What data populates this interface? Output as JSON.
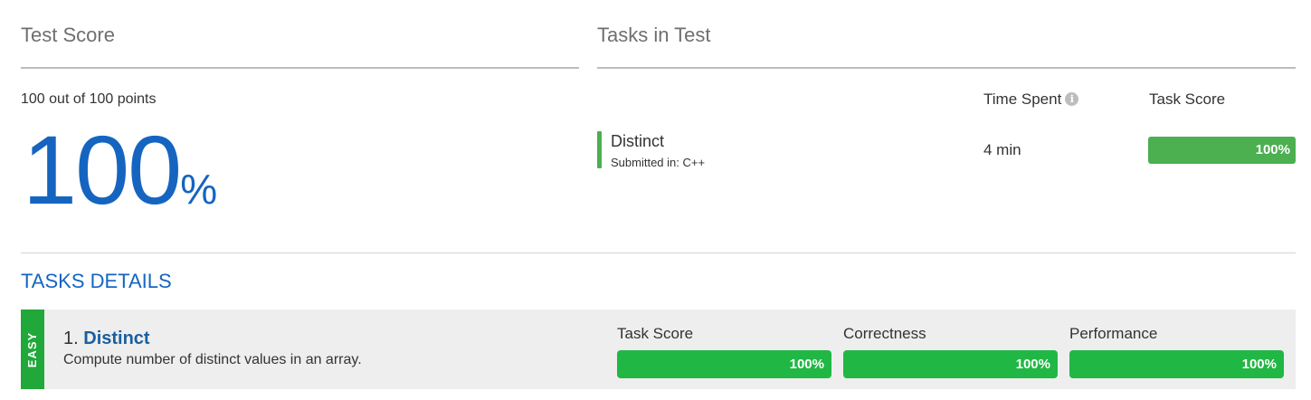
{
  "test_score": {
    "heading": "Test Score",
    "points_text": "100 out of 100 points",
    "big_value": "100",
    "percent_sign": "%"
  },
  "tasks_in_test": {
    "heading": "Tasks in Test",
    "time_spent_header": "Time Spent",
    "info_icon_glyph": "i",
    "task_score_header": "Task Score",
    "rows": [
      {
        "name": "Distinct",
        "submitted_label": "Submitted in: C++",
        "time_spent": "4 min",
        "score_label": "100%",
        "score_fraction": 1.0
      }
    ]
  },
  "tasks_details": {
    "heading": "TASKS DETAILS",
    "cards": [
      {
        "difficulty": "EASY",
        "number_prefix": "1.",
        "name": "Distinct",
        "description": "Compute number of distinct values in an array.",
        "metrics": [
          {
            "label": "Task Score",
            "value": "100%",
            "fraction": 1.0
          },
          {
            "label": "Correctness",
            "value": "100%",
            "fraction": 1.0
          },
          {
            "label": "Performance",
            "value": "100%",
            "fraction": 1.0
          }
        ]
      }
    ]
  },
  "colors": {
    "score_blue": "#1565c0",
    "accent_green": "#4caf50",
    "metric_green": "#21b745",
    "easy_green": "#21a83a",
    "link_blue": "#1a5f9e"
  }
}
